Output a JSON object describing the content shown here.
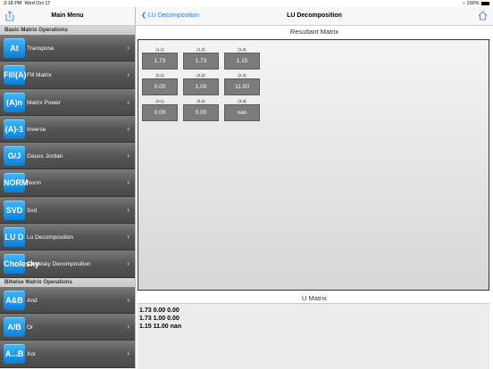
{
  "status_bar": {
    "time": "3:18 PM",
    "date": "Wed Oct 17",
    "battery": "100%"
  },
  "sidebar": {
    "title": "Main Menu",
    "sections": [
      {
        "title": "Basic Matrix Operations",
        "items": [
          {
            "icon_text": "At",
            "label": "Transpose"
          },
          {
            "icon_text": "Fill(A)",
            "label": "Fill Matrix"
          },
          {
            "icon_text": "(A)n",
            "label": "Matrix Power"
          },
          {
            "icon_text": "(A)-1",
            "label": "Inverse"
          },
          {
            "icon_text": "G/J",
            "label": "Gauss Jordan"
          },
          {
            "icon_text": "NORM (A)",
            "label": "Norm"
          },
          {
            "icon_text": "SVD",
            "label": "Svd"
          },
          {
            "icon_text": "LU D",
            "label": "Lu Decomposition"
          },
          {
            "icon_text": "Cholesky",
            "label": "Cholesky Decomposition"
          }
        ]
      },
      {
        "title": "Bitwise Matrix Operations",
        "items": [
          {
            "icon_text": "A&B",
            "label": "And"
          },
          {
            "icon_text": "A/B",
            "label": "Or"
          },
          {
            "icon_text": "A...B",
            "label": "Xor"
          }
        ]
      }
    ]
  },
  "main": {
    "back_label": "LU Decomposition",
    "title": "LU Decomposition",
    "resultant": {
      "title": "Resultant Matrix",
      "cells": [
        [
          {
            "index": "(1,1)",
            "value": "1.73"
          },
          {
            "index": "(1,2)",
            "value": "1.73"
          },
          {
            "index": "(1,3)",
            "value": "1.15"
          }
        ],
        [
          {
            "index": "(2,1)",
            "value": "0.00"
          },
          {
            "index": "(2,2)",
            "value": "1.00"
          },
          {
            "index": "(2,3)",
            "value": "11.00"
          }
        ],
        [
          {
            "index": "(3,1)",
            "value": "0.00"
          },
          {
            "index": "(3,2)",
            "value": "0.00"
          },
          {
            "index": "(3,3)",
            "value": "nan"
          }
        ]
      ]
    },
    "u_matrix": {
      "title": "U Matrix",
      "lines": [
        "1.73  0.00  0.00",
        "1.73  1.00  0.00",
        "1.15  11.00  nan"
      ]
    }
  }
}
